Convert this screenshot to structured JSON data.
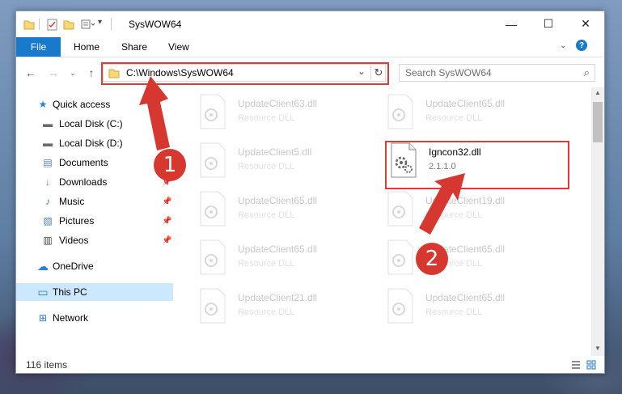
{
  "window": {
    "title": "SysWOW64",
    "controls": {
      "minimize": "—",
      "maximize": "☐",
      "close": "✕"
    }
  },
  "ribbon": {
    "tabs": [
      {
        "label": "File",
        "active": true
      },
      {
        "label": "Home"
      },
      {
        "label": "Share"
      },
      {
        "label": "View"
      }
    ],
    "help_glyph": "?"
  },
  "address_bar": {
    "path": "C:\\Windows\\SysWOW64",
    "dropdown_glyph": "⌄",
    "refresh_glyph": "↻"
  },
  "search": {
    "placeholder": "Search SysWOW64",
    "icon": "⌕"
  },
  "nav_pane": {
    "items": [
      {
        "label": "Quick access",
        "icon": "star-icon",
        "glyph": "★",
        "color": "#2b7fd4"
      },
      {
        "label": "Local Disk (C:)",
        "icon": "drive-icon",
        "glyph": "▬",
        "color": "#6a6a6a",
        "pinned": true
      },
      {
        "label": "Local Disk (D:)",
        "icon": "drive-icon",
        "glyph": "▬",
        "color": "#6a6a6a",
        "pinned": true
      },
      {
        "label": "Documents",
        "icon": "documents-icon",
        "glyph": "▤",
        "color": "#5a7fa8",
        "pinned": true
      },
      {
        "label": "Downloads",
        "icon": "download-icon",
        "glyph": "↓",
        "color": "#2b7fd4",
        "pinned": true
      },
      {
        "label": "Music",
        "icon": "music-icon",
        "glyph": "♪",
        "color": "#2b7fd4",
        "pinned": true
      },
      {
        "label": "Pictures",
        "icon": "pictures-icon",
        "glyph": "▧",
        "color": "#4a7fb5",
        "pinned": true
      },
      {
        "label": "Videos",
        "icon": "videos-icon",
        "glyph": "▥",
        "color": "#444",
        "pinned": true
      },
      {
        "label": "OneDrive",
        "icon": "cloud-icon",
        "glyph": "☁",
        "color": "#2b7fd4"
      },
      {
        "label": "This PC",
        "icon": "computer-icon",
        "glyph": "▭",
        "color": "#2b7fd4",
        "selected": true
      },
      {
        "label": "Network",
        "icon": "network-icon",
        "glyph": "⊞",
        "color": "#2b7fd4"
      }
    ]
  },
  "files": [
    {
      "name": "UpdateClient63.dll",
      "type": "Resource DLL",
      "highlighted": false
    },
    {
      "name": "UpdateClient65.dll",
      "type": "Resource DLL",
      "highlighted": false
    },
    {
      "name": "UpdateClient5.dll",
      "type": "Resource DLL",
      "highlighted": false
    },
    {
      "name": "Igncon32.dll",
      "type": "2.1.1.0",
      "highlighted": true
    },
    {
      "name": "UpdateClient65.dll",
      "type": "Resource DLL",
      "highlighted": false
    },
    {
      "name": "UpdateClient19.dll",
      "type": "Resource DLL",
      "highlighted": false
    },
    {
      "name": "UpdateClient65.dll",
      "type": "Resource DLL",
      "highlighted": false
    },
    {
      "name": "UpdateClient65.dll",
      "type": "Resource DLL",
      "highlighted": false
    },
    {
      "name": "UpdateClient21.dll",
      "type": "Resource DLL",
      "highlighted": false
    },
    {
      "name": "UpdateClient65.dll",
      "type": "Resource DLL",
      "highlighted": false
    }
  ],
  "status_bar": {
    "item_count": "116 items"
  },
  "annotations": {
    "step1": "1",
    "step2": "2",
    "color": "#d6382f"
  }
}
